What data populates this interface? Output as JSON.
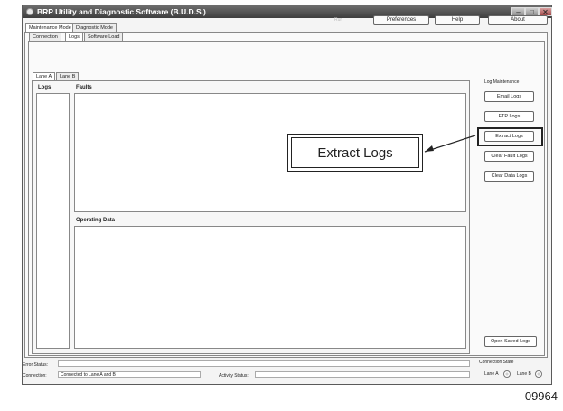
{
  "window": {
    "title": "BRP Utility and Diagnostic Software (B.U.D.S.)"
  },
  "topbar": {
    "run_label": "Run",
    "preferences_label": "Preferences",
    "help_label": "Help",
    "about_label": "About"
  },
  "tabs": {
    "mode": [
      "Maintenance Mode",
      "Diagnostic Mode"
    ],
    "sub": [
      "Connection",
      "Logs",
      "Software Load"
    ],
    "lane": [
      "Lane A",
      "Lane B"
    ]
  },
  "panels": {
    "logs_label": "Logs",
    "faults_label": "Faults",
    "operating_label": "Operating Data"
  },
  "log_maintenance": {
    "label": "Log Maintenance",
    "buttons": [
      "Email Logs",
      "FTP Logs",
      "Extract Logs",
      "Clear Fault Logs",
      "Clear Data Logs"
    ],
    "open_saved": "Open Saved Logs"
  },
  "callout": {
    "text": "Extract Logs"
  },
  "status": {
    "error_label": "Error Status:",
    "error_value": "",
    "connection_label": "Connection:",
    "connection_value": "Connected to Lane A and B",
    "activity_label": "Activity Status:",
    "activity_value": "",
    "connection_state_label": "Connection State",
    "lane_a_label": "Lane A",
    "lane_b_label": "Lane B"
  },
  "figure_number": "09964"
}
